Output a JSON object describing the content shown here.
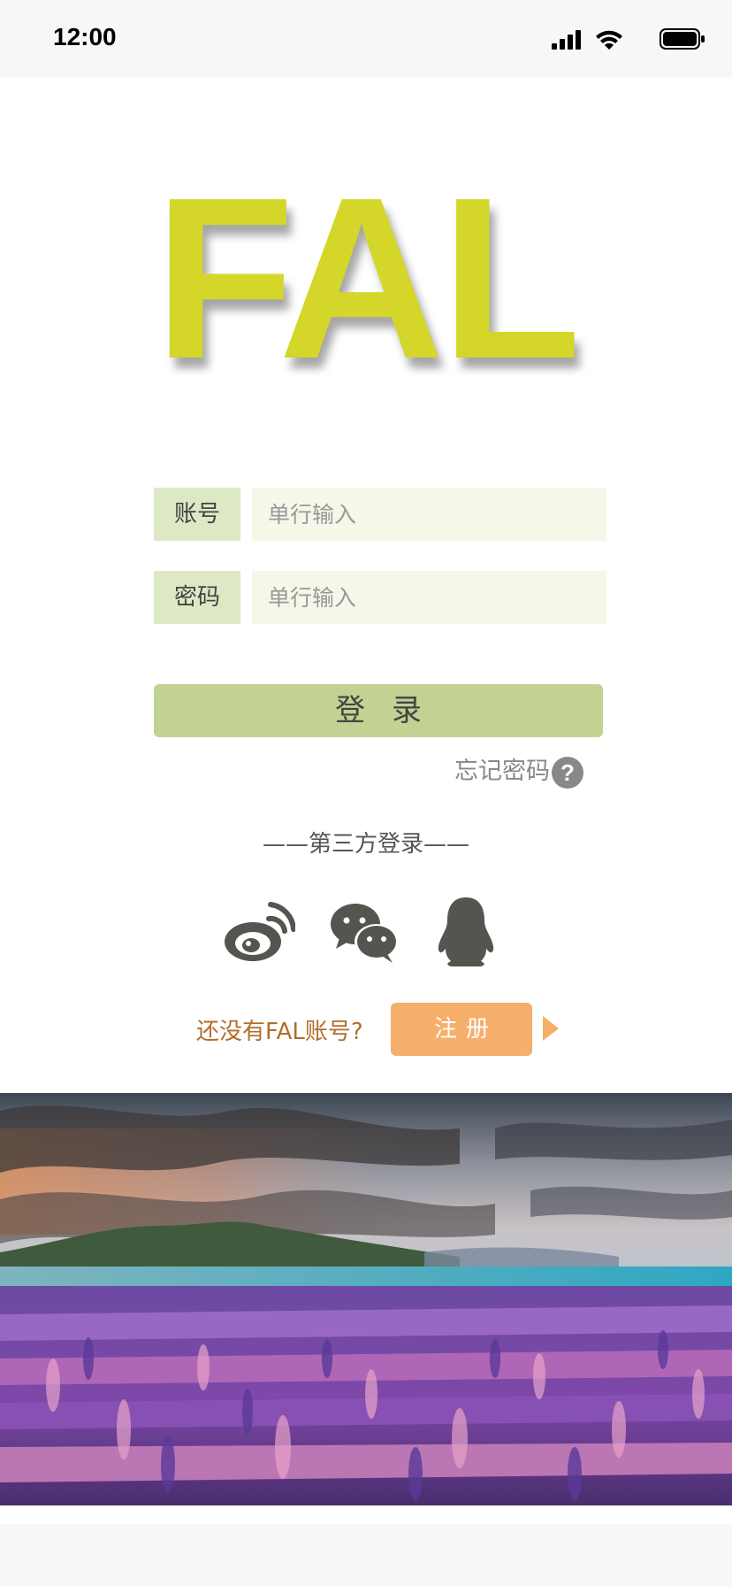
{
  "status_bar": {
    "time": "12:00"
  },
  "logo": {
    "text": "FAL",
    "color": "#d4d629"
  },
  "form": {
    "account": {
      "label": "账号",
      "placeholder": "单行输入",
      "value": ""
    },
    "password": {
      "label": "密码",
      "placeholder": "单行输入",
      "value": ""
    }
  },
  "login_button": {
    "label": "登录",
    "color": "#c2d292"
  },
  "forgot_password": {
    "label": "忘记密码",
    "icon": "?"
  },
  "third_party": {
    "title": "——第三方登录——",
    "providers": [
      {
        "name": "weibo-icon"
      },
      {
        "name": "wechat-icon"
      },
      {
        "name": "qq-icon"
      }
    ]
  },
  "register": {
    "prompt": "还没有FAL账号?",
    "button_label": "注册",
    "button_color": "#f6ae6b"
  },
  "colors": {
    "label_bg": "#dde9c4",
    "input_bg": "#f3f8e8",
    "icon_gray": "#55554f",
    "prompt_text": "#b06e2c"
  }
}
